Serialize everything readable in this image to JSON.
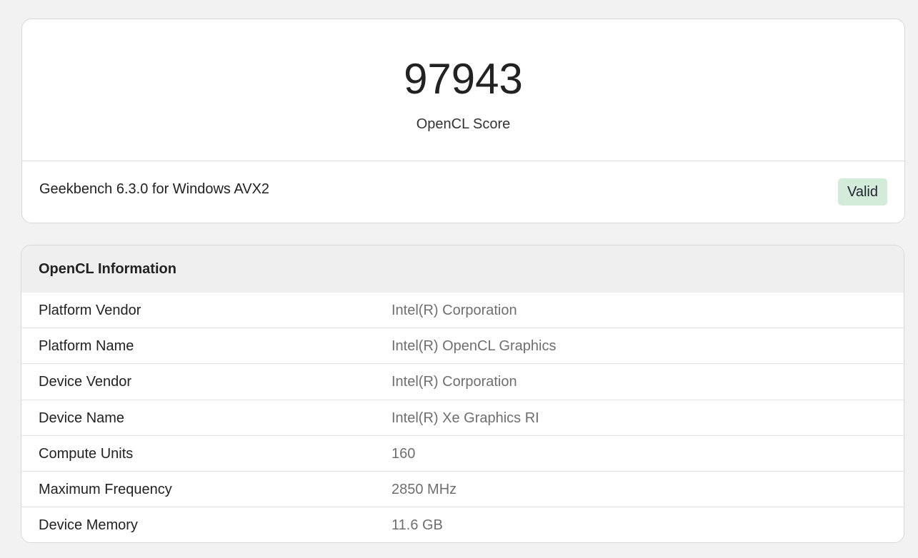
{
  "score_card": {
    "score": "97943",
    "score_label": "OpenCL Score",
    "version": "Geekbench 6.3.0 for Windows AVX2",
    "status": "Valid",
    "status_color": "#d2ecd9"
  },
  "info_card": {
    "title": "OpenCL Information",
    "rows": [
      {
        "key": "Platform Vendor",
        "value": "Intel(R) Corporation"
      },
      {
        "key": "Platform Name",
        "value": "Intel(R) OpenCL Graphics"
      },
      {
        "key": "Device Vendor",
        "value": "Intel(R) Corporation"
      },
      {
        "key": "Device Name",
        "value": "Intel(R) Xe Graphics RI"
      },
      {
        "key": "Compute Units",
        "value": "160"
      },
      {
        "key": "Maximum Frequency",
        "value": "2850 MHz"
      },
      {
        "key": "Device Memory",
        "value": "11.6 GB"
      }
    ]
  }
}
